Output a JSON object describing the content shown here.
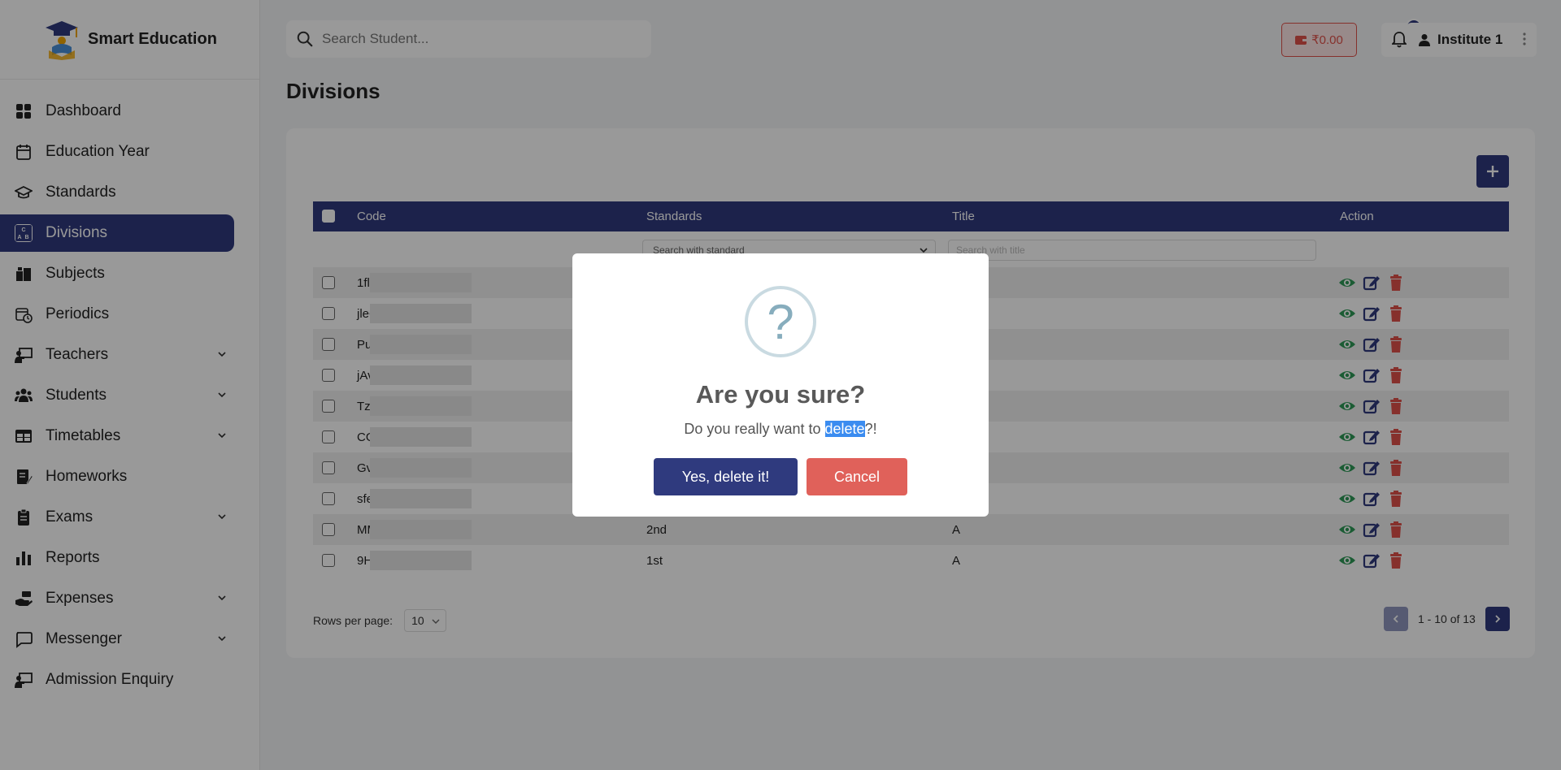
{
  "brand": {
    "name": "Smart Education"
  },
  "sidebar": {
    "items": [
      {
        "label": "Dashboard",
        "icon": "dashboard-grid-icon",
        "expandable": false,
        "active": false
      },
      {
        "label": "Education Year",
        "icon": "calendar-icon",
        "expandable": false,
        "active": false
      },
      {
        "label": "Standards",
        "icon": "graduation-cap-icon",
        "expandable": false,
        "active": false
      },
      {
        "label": "Divisions",
        "icon": "abc-blocks-icon",
        "expandable": false,
        "active": true
      },
      {
        "label": "Subjects",
        "icon": "books-icon",
        "expandable": false,
        "active": false
      },
      {
        "label": "Periodics",
        "icon": "calendar-clock-icon",
        "expandable": false,
        "active": false
      },
      {
        "label": "Teachers",
        "icon": "teacher-board-icon",
        "expandable": true,
        "active": false
      },
      {
        "label": "Students",
        "icon": "users-icon",
        "expandable": true,
        "active": false
      },
      {
        "label": "Timetables",
        "icon": "table-icon",
        "expandable": true,
        "active": false
      },
      {
        "label": "Homeworks",
        "icon": "notebook-pen-icon",
        "expandable": false,
        "active": false
      },
      {
        "label": "Exams",
        "icon": "clipboard-icon",
        "expandable": true,
        "active": false
      },
      {
        "label": "Reports",
        "icon": "bar-chart-icon",
        "expandable": false,
        "active": false
      },
      {
        "label": "Expenses",
        "icon": "hand-money-icon",
        "expandable": true,
        "active": false
      },
      {
        "label": "Messenger",
        "icon": "message-icon",
        "expandable": true,
        "active": false
      },
      {
        "label": "Admission Enquiry",
        "icon": "enquiry-board-icon",
        "expandable": false,
        "active": false
      }
    ]
  },
  "header": {
    "search_placeholder": "Search Student...",
    "wallet_amount": "₹0.00",
    "notification_count": "0",
    "user_name": "Institute 1"
  },
  "main": {
    "title": "Divisions",
    "table": {
      "columns": {
        "code": "Code",
        "standards": "Standards",
        "title": "Title",
        "action": "Action"
      },
      "filters": {
        "standard_placeholder": "Search with standard",
        "title_placeholder": "Search with title"
      },
      "rows": [
        {
          "code": "1fl",
          "standard": "",
          "title": ""
        },
        {
          "code": "jleC",
          "standard": "",
          "title": ""
        },
        {
          "code": "Puu",
          "standard": "",
          "title": ""
        },
        {
          "code": "jAv",
          "standard": "",
          "title": ""
        },
        {
          "code": "TzX",
          "standard": "",
          "title": ""
        },
        {
          "code": "CG",
          "standard": "",
          "title": ""
        },
        {
          "code": "GvEc",
          "standard": "",
          "title": ""
        },
        {
          "code": "sfe",
          "standard": "",
          "title": ""
        },
        {
          "code": "MM",
          "standard": "2nd",
          "title": "A"
        },
        {
          "code": "9Ht",
          "standard": "1st",
          "title": "A"
        }
      ]
    },
    "pagination": {
      "rows_per_page_label": "Rows per page:",
      "rows_per_page": "10",
      "range": "1 - 10 of 13"
    }
  },
  "modal": {
    "title": "Are you sure?",
    "text_before": "Do you really want to ",
    "text_highlight": "delete",
    "text_after": "?!",
    "confirm_label": "Yes, delete it!",
    "cancel_label": "Cancel"
  },
  "colors": {
    "primary": "#2f3a7e",
    "danger": "#e0615a",
    "view_icon": "#2e9a57"
  }
}
